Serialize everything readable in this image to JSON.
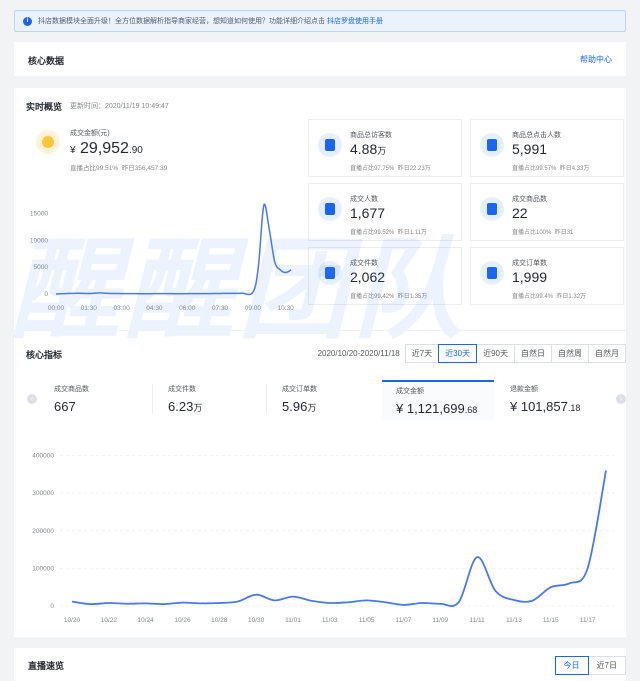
{
  "notice": {
    "text": "抖店数据模块全面升级！全方位数据解析指导商家经营，想知道如何使用？功能详细介绍点击",
    "link": "抖店罗盘使用手册"
  },
  "core_data": {
    "title": "核心数据",
    "help": "帮助中心"
  },
  "realtime": {
    "title": "实时概览",
    "update_time": "更新时间：2020/11/19 10:49:47",
    "gmv": {
      "label": "成交金额(元)",
      "currency": "¥",
      "value_main": "29,952",
      "value_dec": ".90",
      "live_share": "直播占比99.51%",
      "yesterday": "昨日356,457.39"
    },
    "mini": [
      {
        "label": "商品总访客数",
        "num": "4.88",
        "unit": "万",
        "share": "直播占比97.75%",
        "yesterday": "昨日22.23万",
        "icon": "visitor-icon"
      },
      {
        "label": "商品总点击人数",
        "num": "5,991",
        "unit": "",
        "share": "直播占比99.57%",
        "yesterday": "昨日4.33万",
        "icon": "click-icon"
      },
      {
        "label": "成交人数",
        "num": "1,677",
        "unit": "",
        "share": "直播占比99.52%",
        "yesterday": "昨日1.11万",
        "icon": "buyer-icon"
      },
      {
        "label": "成交商品数",
        "num": "22",
        "unit": "",
        "share": "直播占比100%",
        "yesterday": "昨日31",
        "icon": "product-icon"
      },
      {
        "label": "成交件数",
        "num": "2,062",
        "unit": "",
        "share": "直播占比99.42%",
        "yesterday": "昨日1.35万",
        "icon": "package-icon"
      },
      {
        "label": "成交订单数",
        "num": "1,999",
        "unit": "",
        "share": "直播占比99.4%",
        "yesterday": "昨日1.32万",
        "icon": "order-icon"
      }
    ]
  },
  "core_metrics": {
    "title": "核心指标",
    "range": "2020/10/20-2020/11/18",
    "tabs": [
      "近7天",
      "近30天",
      "近90天",
      "自然日",
      "自然周",
      "自然月"
    ],
    "active_tab": "近30天",
    "kpis": [
      {
        "label": "成交商品数",
        "num": "667",
        "unit": "",
        "dec": ""
      },
      {
        "label": "成交件数",
        "num": "6.23",
        "unit": "万",
        "dec": ""
      },
      {
        "label": "成交订单数",
        "num": "5.96",
        "unit": "万",
        "dec": ""
      },
      {
        "label": "成交金额",
        "num": "¥ 1,121,699",
        "unit": "",
        "dec": ".68"
      },
      {
        "label": "退款金额",
        "num": "¥ 101,857",
        "unit": "",
        "dec": ".18"
      }
    ]
  },
  "live": {
    "title": "直播速览",
    "tabs": [
      "今日",
      "近7日"
    ]
  },
  "watermark": "醒醒团队",
  "colors": {
    "accent": "#1966ff",
    "line": "#4a78f0"
  },
  "chart_data": [
    {
      "type": "line",
      "x_ticks": [
        "00:00",
        "01:30",
        "03:00",
        "04:30",
        "06:00",
        "07:30",
        "09:00",
        "10:30"
      ],
      "y_ticks": [
        "0",
        "5000",
        "10000",
        "15000"
      ],
      "ylim": [
        0,
        17500
      ],
      "x": [
        0,
        0.5,
        1,
        1.5,
        2,
        2.5,
        3,
        3.5,
        4,
        4.5,
        5,
        5.5,
        6,
        6.5,
        7,
        7.5,
        8,
        8.5,
        9,
        9.25,
        9.5,
        9.75,
        10,
        10.25,
        10.5,
        10.75
      ],
      "y": [
        0,
        100,
        150,
        100,
        200,
        100,
        80,
        60,
        50,
        60,
        70,
        50,
        60,
        60,
        80,
        100,
        120,
        150,
        300,
        5000,
        16500,
        12000,
        6000,
        4500,
        4000,
        4500
      ],
      "series_name": ""
    },
    {
      "type": "line",
      "x_ticks": [
        "10/20",
        "10/22",
        "10/24",
        "10/26",
        "10/28",
        "10/30",
        "11/01",
        "11/03",
        "11/05",
        "11/07",
        "11/09",
        "11/11",
        "11/13",
        "11/15",
        "11/17"
      ],
      "y_ticks": [
        "0",
        "100000",
        "200000",
        "300000",
        "400000"
      ],
      "ylim": [
        0,
        420000
      ],
      "x": [
        "10/20",
        "10/21",
        "10/22",
        "10/23",
        "10/24",
        "10/25",
        "10/26",
        "10/27",
        "10/28",
        "10/29",
        "10/30",
        "10/31",
        "11/01",
        "11/02",
        "11/03",
        "11/04",
        "11/05",
        "11/06",
        "11/07",
        "11/08",
        "11/09",
        "11/10",
        "11/11",
        "11/12",
        "11/13",
        "11/14",
        "11/15",
        "11/16",
        "11/17",
        "11/18"
      ],
      "y": [
        12000,
        5000,
        8000,
        6000,
        7000,
        5000,
        9000,
        7000,
        8000,
        12000,
        30000,
        15000,
        25000,
        14000,
        8000,
        10000,
        15000,
        10000,
        3000,
        8000,
        6000,
        10000,
        130000,
        40000,
        16000,
        14000,
        50000,
        60000,
        100000,
        360000
      ],
      "series_name": ""
    }
  ]
}
